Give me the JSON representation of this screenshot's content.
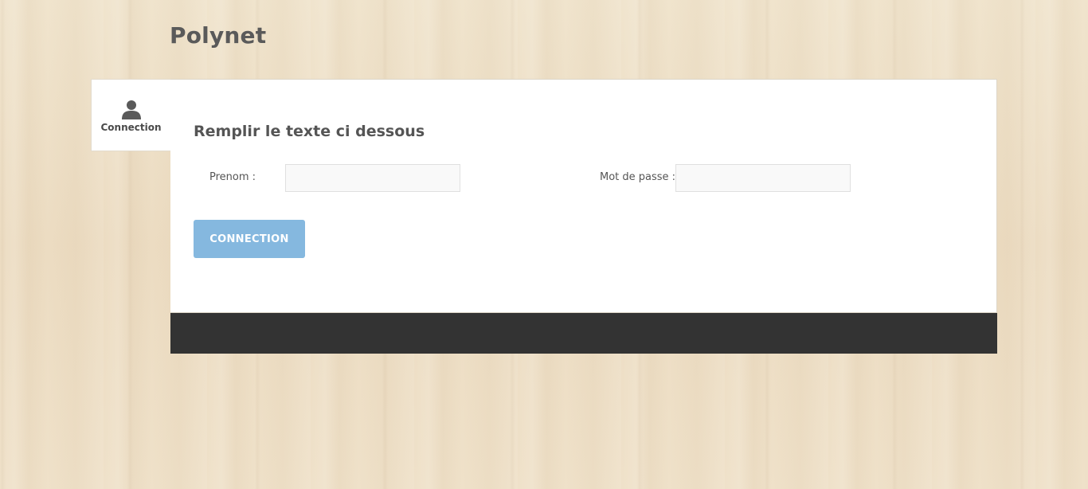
{
  "header": {
    "title": "Polynet"
  },
  "sidebar": {
    "tab_label": "Connection",
    "tab_icon": "user-icon"
  },
  "form": {
    "heading": "Remplir le texte ci dessous",
    "prenom_label": "Prenom :",
    "prenom_value": "",
    "password_label": "Mot de passe :",
    "password_value": "",
    "submit_label": "CONNECTION"
  },
  "colors": {
    "button": "#85b8df",
    "footer": "#333333",
    "title": "#5a5a5a"
  }
}
